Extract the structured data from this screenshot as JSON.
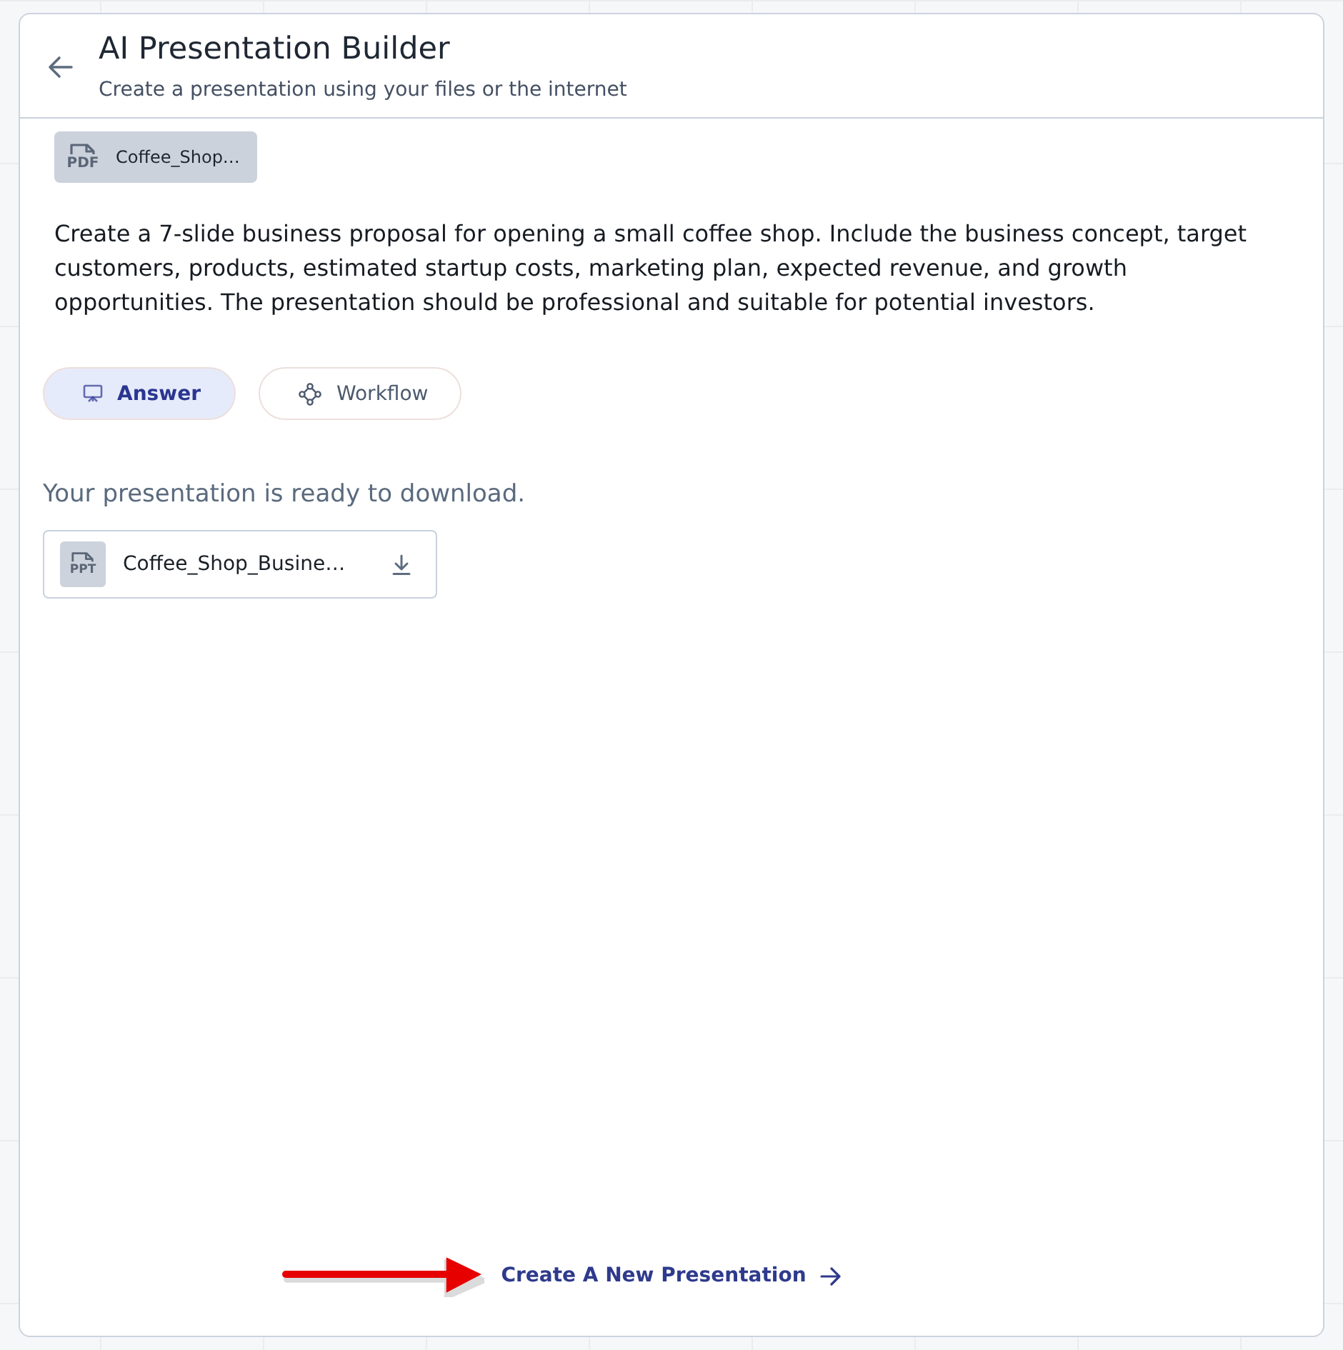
{
  "header": {
    "title": "AI Presentation Builder",
    "subtitle": "Create a presentation using your files or the internet"
  },
  "attachments": [
    {
      "type_label": "PDF",
      "name": "Coffee_Shop…"
    }
  ],
  "prompt": "Create a 7-slide business proposal for opening a small coffee shop. Include the business concept, target customers, products, estimated startup costs, marketing plan, expected revenue, and growth opportunities. The presentation should be professional and suitable for potential investors.",
  "tabs": [
    {
      "label": "Answer",
      "kind": "answer",
      "selected": true
    },
    {
      "label": "Workflow",
      "kind": "workflow",
      "selected": false
    }
  ],
  "status_message": "Your presentation is ready to download.",
  "files": [
    {
      "type_label": "PPT",
      "name": "Coffee_Shop_Busine…"
    }
  ],
  "footer_link": {
    "label": "Create A New Presentation"
  },
  "annotation": {
    "kind": "arrow"
  }
}
